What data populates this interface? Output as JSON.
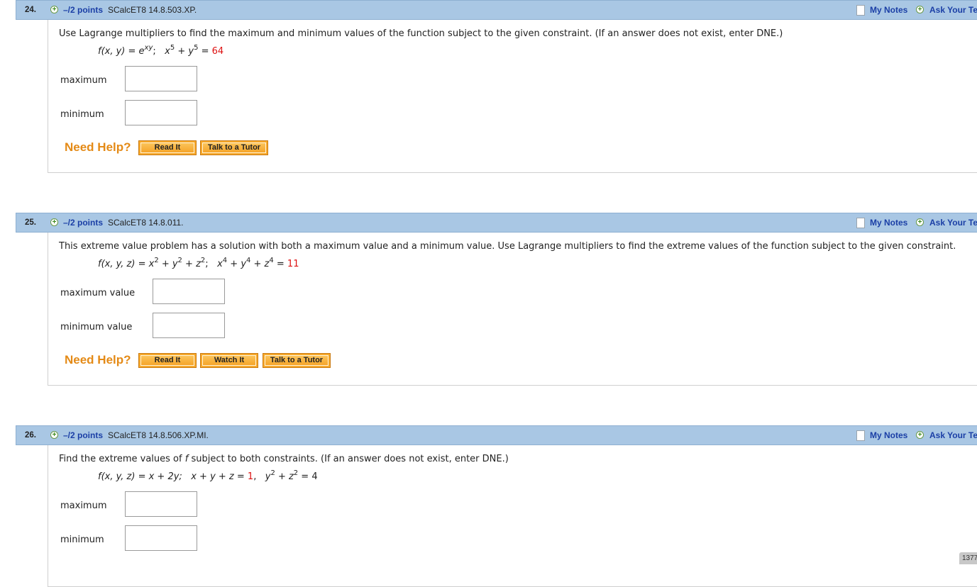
{
  "questions": [
    {
      "number": "24.",
      "points": "–/2 points",
      "id": "SCalcET8 14.8.503.XP.",
      "my_notes": "My Notes",
      "ask_teacher": "Ask Your Teacher",
      "prompt": "Use Lagrange multipliers to find the maximum and minimum values of the function subject to the given constraint. (If an answer does not exist, enter DNE.)",
      "formula": {
        "lhs": "f(x, y) = e",
        "exp": "xy",
        "sep": ";",
        "c1": "x",
        "c1_exp": "5",
        "c2": " + y",
        "c2_exp": "5",
        "eq": " = ",
        "rhs": "64"
      },
      "fields": [
        {
          "label": "maximum",
          "value": ""
        },
        {
          "label": "minimum",
          "value": ""
        }
      ],
      "need_help": "Need Help?",
      "help_buttons": [
        "Read It",
        "Talk to a Tutor"
      ]
    },
    {
      "number": "25.",
      "points": "–/2 points",
      "id": "SCalcET8 14.8.011.",
      "my_notes": "My Notes",
      "ask_teacher": "Ask Your Teacher",
      "prompt": "This extreme value problem has a solution with both a maximum value and a minimum value. Use Lagrange multipliers to find the extreme values of the function subject to the given constraint.",
      "formula": {
        "lhs": "f(x, y, z) = x",
        "e1": "2",
        "p2": " + y",
        "e2": "2",
        "p3": " + z",
        "e3": "2",
        "sep": ";",
        "c1": "x",
        "c1_exp": "4",
        "c2": " + y",
        "c2_exp": "4",
        "c3": " + z",
        "c3_exp": "4",
        "eq": " = ",
        "rhs": "11"
      },
      "fields": [
        {
          "label": "maximum value",
          "value": ""
        },
        {
          "label": "minimum value",
          "value": ""
        }
      ],
      "need_help": "Need Help?",
      "help_buttons": [
        "Read It",
        "Watch It",
        "Talk to a Tutor"
      ]
    },
    {
      "number": "26.",
      "points": "–/2 points",
      "id": "SCalcET8 14.8.506.XP.MI.",
      "my_notes": "My Notes",
      "ask_teacher": "Ask Your Teacher",
      "prompt_pre": "Find the extreme values of ",
      "prompt_f": "f",
      "prompt_post": " subject to both constraints. (If an answer does not exist, enter DNE.)",
      "formula": {
        "lhs": "f(x, y, z) = x + 2y;",
        "c1": "x + y + z = ",
        "c1_rhs": "1",
        "comma": ",",
        "c2": "y",
        "c2_exp": "2",
        "c3": " + z",
        "c3_exp": "2",
        "eq": " = 4"
      },
      "fields": [
        {
          "label": "maximum",
          "value": ""
        },
        {
          "label": "minimum",
          "value": ""
        }
      ]
    }
  ],
  "page_badge": "1377"
}
